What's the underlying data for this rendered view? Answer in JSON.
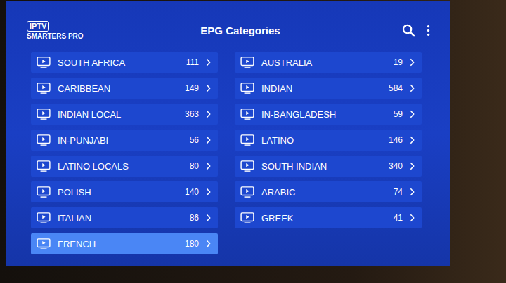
{
  "app": {
    "logo_top": "IPTV",
    "logo_bottom": "SMARTERS PRO"
  },
  "header": {
    "title": "EPG Categories"
  },
  "columns": [
    [
      {
        "name": "SOUTH AFRICA",
        "count": "111",
        "selected": false
      },
      {
        "name": "CARIBBEAN",
        "count": "149",
        "selected": false
      },
      {
        "name": "INDIAN LOCAL",
        "count": "363",
        "selected": false
      },
      {
        "name": "IN-PUNJABI",
        "count": "56",
        "selected": false
      },
      {
        "name": "LATINO LOCALS",
        "count": "80",
        "selected": false
      },
      {
        "name": "POLISH",
        "count": "140",
        "selected": false
      },
      {
        "name": "ITALIAN",
        "count": "86",
        "selected": false
      },
      {
        "name": "FRENCH",
        "count": "180",
        "selected": true
      }
    ],
    [
      {
        "name": "AUSTRALIA",
        "count": "19",
        "selected": false
      },
      {
        "name": "INDIAN",
        "count": "584",
        "selected": false
      },
      {
        "name": "IN-BANGLADESH",
        "count": "59",
        "selected": false
      },
      {
        "name": "LATINO",
        "count": "146",
        "selected": false
      },
      {
        "name": "SOUTH INDIAN",
        "count": "340",
        "selected": false
      },
      {
        "name": "ARABIC",
        "count": "74",
        "selected": false
      },
      {
        "name": "GREEK",
        "count": "41",
        "selected": false
      }
    ]
  ]
}
